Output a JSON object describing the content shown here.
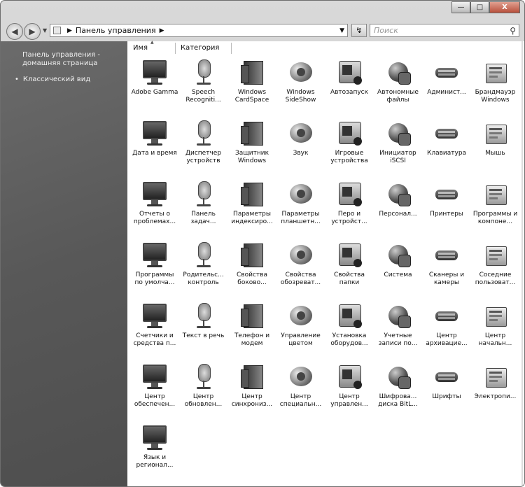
{
  "window": {
    "minimize": "—",
    "maximize": "□",
    "close": "X"
  },
  "address": {
    "crumb": "Панель управления",
    "search_placeholder": "Поиск"
  },
  "sidebar": {
    "home_link": "Панель управления - домашняя страница",
    "classic_view": "Классический вид"
  },
  "columns": {
    "name": "Имя",
    "category": "Категория"
  },
  "items": [
    {
      "label": "Adobe Gamma",
      "icon": "monitor-icon"
    },
    {
      "label": "Speech Recogniti...",
      "icon": "microphone-icon"
    },
    {
      "label": "Windows CardSpace",
      "icon": "cardspace-icon"
    },
    {
      "label": "Windows SideShow",
      "icon": "sideshow-icon"
    },
    {
      "label": "Автозапуск",
      "icon": "autoplay-icon"
    },
    {
      "label": "Автономные файлы",
      "icon": "offline-files-icon"
    },
    {
      "label": "Админист...",
      "icon": "admin-tools-icon"
    },
    {
      "label": "Брандмауэр Windows",
      "icon": "firewall-icon"
    },
    {
      "label": "Дата и время",
      "icon": "calendar-clock-icon"
    },
    {
      "label": "Диспетчер устройств",
      "icon": "device-manager-icon"
    },
    {
      "label": "Защитник Windows",
      "icon": "defender-icon"
    },
    {
      "label": "Звук",
      "icon": "speaker-icon"
    },
    {
      "label": "Игровые устройства",
      "icon": "gamepad-icon"
    },
    {
      "label": "Инициатор iSCSI",
      "icon": "iscsi-globe-icon"
    },
    {
      "label": "Клавиатура",
      "icon": "keyboard-icon"
    },
    {
      "label": "Мышь",
      "icon": "mouse-icon"
    },
    {
      "label": "Отчеты о проблемах...",
      "icon": "problem-reports-icon"
    },
    {
      "label": "Панель задач...",
      "icon": "taskbar-icon"
    },
    {
      "label": "Параметры индексиро...",
      "icon": "indexing-icon"
    },
    {
      "label": "Параметры планшетн...",
      "icon": "tablet-icon"
    },
    {
      "label": "Перо и устройст...",
      "icon": "pen-icon"
    },
    {
      "label": "Персонал...",
      "icon": "personalization-icon"
    },
    {
      "label": "Принтеры",
      "icon": "printer-icon"
    },
    {
      "label": "Программы и компоне...",
      "icon": "programs-icon"
    },
    {
      "label": "Программы по умолча...",
      "icon": "default-programs-icon"
    },
    {
      "label": "Родительс... контроль",
      "icon": "parental-control-icon"
    },
    {
      "label": "Свойства боково...",
      "icon": "sidebar-properties-icon"
    },
    {
      "label": "Свойства обозреват...",
      "icon": "internet-options-icon"
    },
    {
      "label": "Свойства папки",
      "icon": "folder-options-icon"
    },
    {
      "label": "Система",
      "icon": "system-icon"
    },
    {
      "label": "Сканеры и камеры",
      "icon": "scanner-icon"
    },
    {
      "label": "Соседние пользоват...",
      "icon": "people-near-me-icon"
    },
    {
      "label": "Счетчики и средства п...",
      "icon": "performance-icon"
    },
    {
      "label": "Текст в речь",
      "icon": "text-to-speech-icon"
    },
    {
      "label": "Телефон и модем",
      "icon": "phone-modem-icon"
    },
    {
      "label": "Управление цветом",
      "icon": "color-management-icon"
    },
    {
      "label": "Установка оборудов...",
      "icon": "add-hardware-icon"
    },
    {
      "label": "Учетные записи по...",
      "icon": "user-accounts-icon"
    },
    {
      "label": "Центр архивацие...",
      "icon": "backup-center-icon"
    },
    {
      "label": "Центр начальн...",
      "icon": "welcome-center-icon"
    },
    {
      "label": "Центр обеспечен...",
      "icon": "security-center-icon"
    },
    {
      "label": "Центр обновлен...",
      "icon": "windows-update-icon"
    },
    {
      "label": "Центр синхрониз...",
      "icon": "sync-center-icon"
    },
    {
      "label": "Центр специальн...",
      "icon": "ease-of-access-icon"
    },
    {
      "label": "Центр управлен...",
      "icon": "mobility-center-icon"
    },
    {
      "label": "Шифрова... диска BitL...",
      "icon": "bitlocker-icon"
    },
    {
      "label": "Шрифты",
      "icon": "fonts-icon"
    },
    {
      "label": "Электропи...",
      "icon": "power-options-icon"
    },
    {
      "label": "Язык и регионал...",
      "icon": "regional-options-icon"
    }
  ]
}
